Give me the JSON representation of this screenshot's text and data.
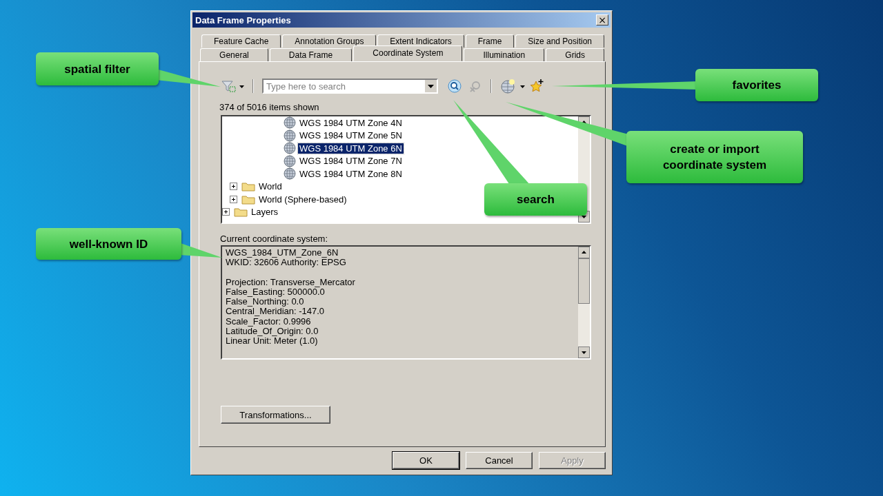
{
  "window": {
    "title": "Data Frame Properties",
    "close": "×"
  },
  "tab_rows": [
    {
      "tabs": [
        {
          "label": "Feature Cache",
          "selected": false
        },
        {
          "label": "Annotation Groups",
          "selected": false
        },
        {
          "label": "Extent Indicators",
          "selected": false
        },
        {
          "label": "Frame",
          "selected": false
        },
        {
          "label": "Size and Position",
          "selected": false
        }
      ]
    },
    {
      "tabs": [
        {
          "label": "General",
          "selected": false
        },
        {
          "label": "Data Frame",
          "selected": false
        },
        {
          "label": "Coordinate System",
          "selected": true
        },
        {
          "label": "Illumination",
          "selected": false
        },
        {
          "label": "Grids",
          "selected": false
        }
      ]
    }
  ],
  "search": {
    "placeholder": "Type here to search"
  },
  "items_shown": "374 of 5016 items shown",
  "tree": {
    "items": [
      {
        "children": [
          {
            "children": [
              {
                "children": [
                  {
                    "children": [
                      {
                        "label": "WGS 1984 UTM Zone 4N",
                        "kind": "crs",
                        "selected": false
                      },
                      {
                        "label": "WGS 1984 UTM Zone 5N",
                        "kind": "crs",
                        "selected": false
                      },
                      {
                        "label": "WGS 1984 UTM Zone 6N",
                        "kind": "crs",
                        "selected": true
                      },
                      {
                        "label": "WGS 1984 UTM Zone 7N",
                        "kind": "crs",
                        "selected": false
                      },
                      {
                        "label": "WGS 1984 UTM Zone 8N",
                        "kind": "crs",
                        "selected": false
                      }
                    ]
                  }
                ]
              }
            ]
          },
          {
            "label": "World",
            "kind": "folder",
            "selected": false,
            "expanded": false
          },
          {
            "label": "World (Sphere-based)",
            "kind": "folder",
            "selected": false,
            "expanded": false
          }
        ]
      },
      {
        "label": "Layers",
        "kind": "folder",
        "selected": false,
        "expanded": false
      }
    ]
  },
  "current_label": "Current coordinate system:",
  "details": [
    {
      "lines": [
        "WGS_1984_UTM_Zone_6N",
        "WKID: 32606 Authority: EPSG"
      ]
    },
    {
      "lines": [
        "Projection: Transverse_Mercator",
        "False_Easting: 500000.0",
        "False_Northing: 0.0",
        "Central_Meridian: -147.0",
        "Scale_Factor: 0.9996",
        "Latitude_Of_Origin: 0.0",
        "Linear Unit: Meter (1.0)"
      ]
    }
  ],
  "transformations_button": "Transformations...",
  "buttons": [
    {
      "label": "OK",
      "kind": "default",
      "disabled": false
    },
    {
      "label": "Cancel",
      "kind": "normal",
      "disabled": false
    },
    {
      "label": "Apply",
      "kind": "normal",
      "disabled": true
    }
  ],
  "callouts": [
    {
      "text": "spatial filter",
      "kind": "filter"
    },
    {
      "text": "favorites",
      "kind": "favorites"
    },
    {
      "text": "create or import coordinate system",
      "kind": "create"
    },
    {
      "text": "search",
      "kind": "search"
    },
    {
      "text": "well-known ID",
      "kind": "wkid"
    }
  ]
}
